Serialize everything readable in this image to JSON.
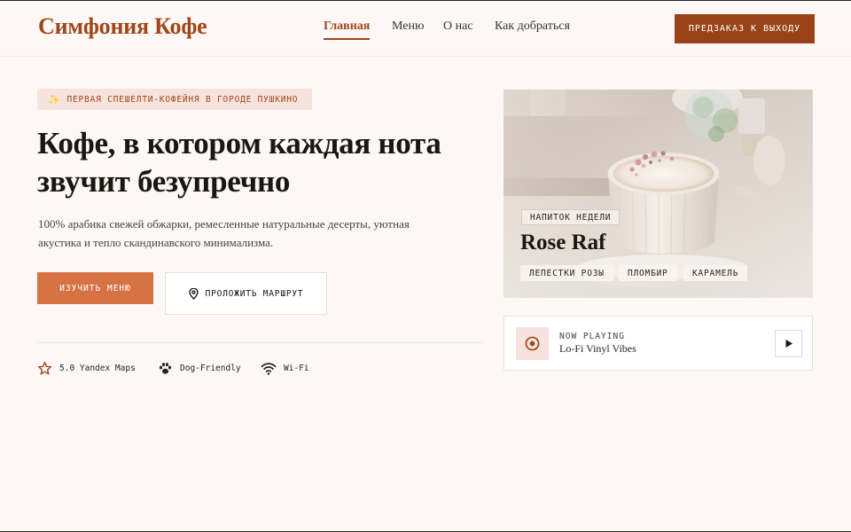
{
  "brand": "Симфония Кофе",
  "nav": {
    "items": [
      "Главная",
      "Меню",
      "О нас",
      "Как добраться"
    ]
  },
  "header": {
    "preorder_label": "ПРЕДЗАКАЗ К ВЫХОДУ"
  },
  "hero": {
    "badge": "ПЕРВАЯ СПЕШЕЛТИ-КОФЕЙНЯ В ГОРОДЕ ПУШКИНО",
    "title": "Кофе, в котором каждая нота звучит безупречно",
    "lead": "100% арабика свежей обжарки, ремесленные натуральные десерты, уютная акустика и тепло скандинавского минимализма.",
    "menu_button": "ИЗУЧИТЬ МЕНЮ",
    "route_button": "ПРОЛОЖИТЬ МАРШРУТ"
  },
  "features": [
    "5.0 Yandex Maps",
    "Dog-Friendly",
    "Wi-Fi"
  ],
  "drink": {
    "tag": "НАПИТОК НЕДЕЛИ",
    "name": "Rose Raf",
    "chips": [
      "ЛЕПЕСТКИ РОЗЫ",
      "ПЛОМБИР",
      "КАРАМЕЛЬ"
    ]
  },
  "player": {
    "label": "NOW PLAYING",
    "track": "Lo-Fi Vinyl Vibes"
  },
  "colors": {
    "accent": "#a0471a",
    "accent_soft": "#d67243",
    "background": "#fdf8f5",
    "badge_bg": "#f7e3dd"
  },
  "icons": {
    "badge": "sparkle-icon",
    "route": "map-pin-icon",
    "features": [
      "star-icon",
      "paw-icon",
      "wifi-icon"
    ],
    "vinyl": "vinyl-record-icon",
    "play": "play-icon"
  }
}
